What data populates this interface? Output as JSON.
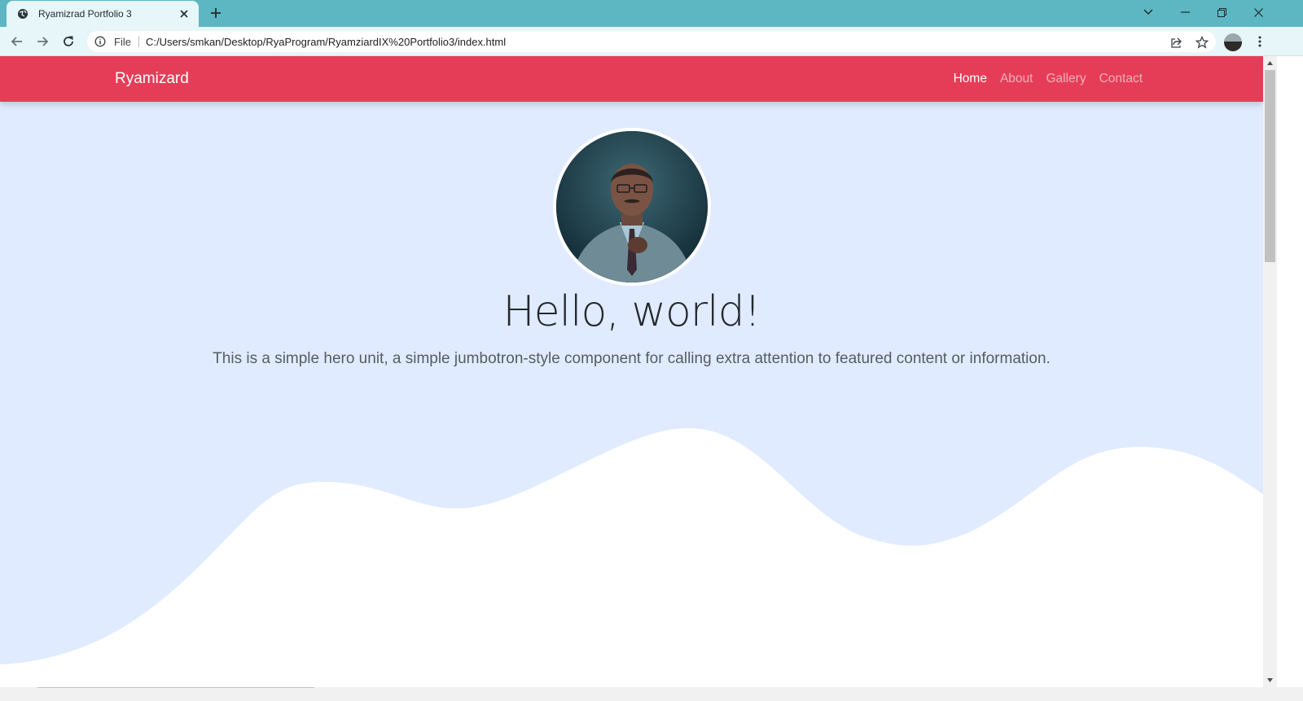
{
  "browser": {
    "tab_title": "Ryamizrad Portfolio 3",
    "url_scheme": "File",
    "url": "C:/Users/smkan/Desktop/RyaProgram/RyamziardIX%20Portfolio3/index.html"
  },
  "navbar": {
    "brand": "Ryamizard",
    "links": [
      {
        "label": "Home",
        "active": true
      },
      {
        "label": "About",
        "active": false
      },
      {
        "label": "Gallery",
        "active": false
      },
      {
        "label": "Contact",
        "active": false
      }
    ]
  },
  "hero": {
    "title": "Hello, world!",
    "lead": "This is a simple hero unit, a simple jumbotron-style component for calling extra attention to featured content or information."
  },
  "colors": {
    "chrome": "#5cb7c2",
    "navbar": "#e53d57",
    "hero_bg": "#e0ebff",
    "wave": "#ffffff"
  }
}
